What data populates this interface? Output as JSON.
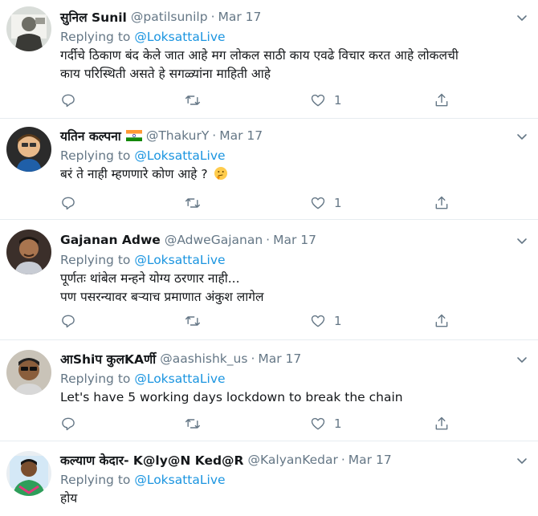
{
  "tweets": [
    {
      "name": "सुनिल Sunil",
      "handle": "@patilsunilp",
      "sep": "·",
      "date": "Mar 17",
      "replying_prefix": "Replying to",
      "replying_to": "@LoksattaLive",
      "lines": [
        "गर्दीचे ठिकाण बंद केले जात आहे मग लोकल साठी काय एवढे विचार करत आहे लोकलची",
        "काय परिस्थिती असते हे सगळ्यांना माहिती आहे"
      ],
      "likes": "1"
    },
    {
      "name": "यतिन कल्पना",
      "handle": "@ThakurY",
      "sep": "·",
      "date": "Mar 17",
      "replying_prefix": "Replying to",
      "replying_to": "@LoksattaLive",
      "lines": [
        "बरं ते नाही म्हणणारे कोण आहे ?"
      ],
      "likes": "1"
    },
    {
      "name": "Gajanan Adwe",
      "handle": "@AdweGajanan",
      "sep": "·",
      "date": "Mar 17",
      "replying_prefix": "Replying to",
      "replying_to": "@LoksattaLive",
      "lines": [
        "पूर्णतः थांबेल मन्हने योग्य ठरणार नाही...",
        "पण पसरन्यावर बऱ्याच प्रमाणात अंकुश लागेल"
      ],
      "likes": "1"
    },
    {
      "name": "आShiप कुलKAर्णी",
      "handle": "@aashishk_us",
      "sep": "·",
      "date": "Mar 17",
      "replying_prefix": "Replying to",
      "replying_to": "@LoksattaLive",
      "lines": [
        "Let's have 5 working days lockdown to break the chain"
      ],
      "likes": "1"
    },
    {
      "name": "कल्याण केदार- K@ly@N Ked@R",
      "handle": "@KalyanKedar",
      "sep": "·",
      "date": "Mar 17",
      "replying_prefix": "Replying to",
      "replying_to": "@LoksattaLive",
      "lines": [
        "होय"
      ],
      "likes": ""
    }
  ],
  "colors": {
    "link": "#1b95e0",
    "muted": "#657786",
    "text": "#14171a",
    "divider": "#e6ecf0"
  },
  "icons": [
    "reply-icon",
    "retweet-icon",
    "like-icon",
    "share-icon",
    "chevron-down-icon",
    "india-flag-icon",
    "thinking-face-emoji"
  ]
}
